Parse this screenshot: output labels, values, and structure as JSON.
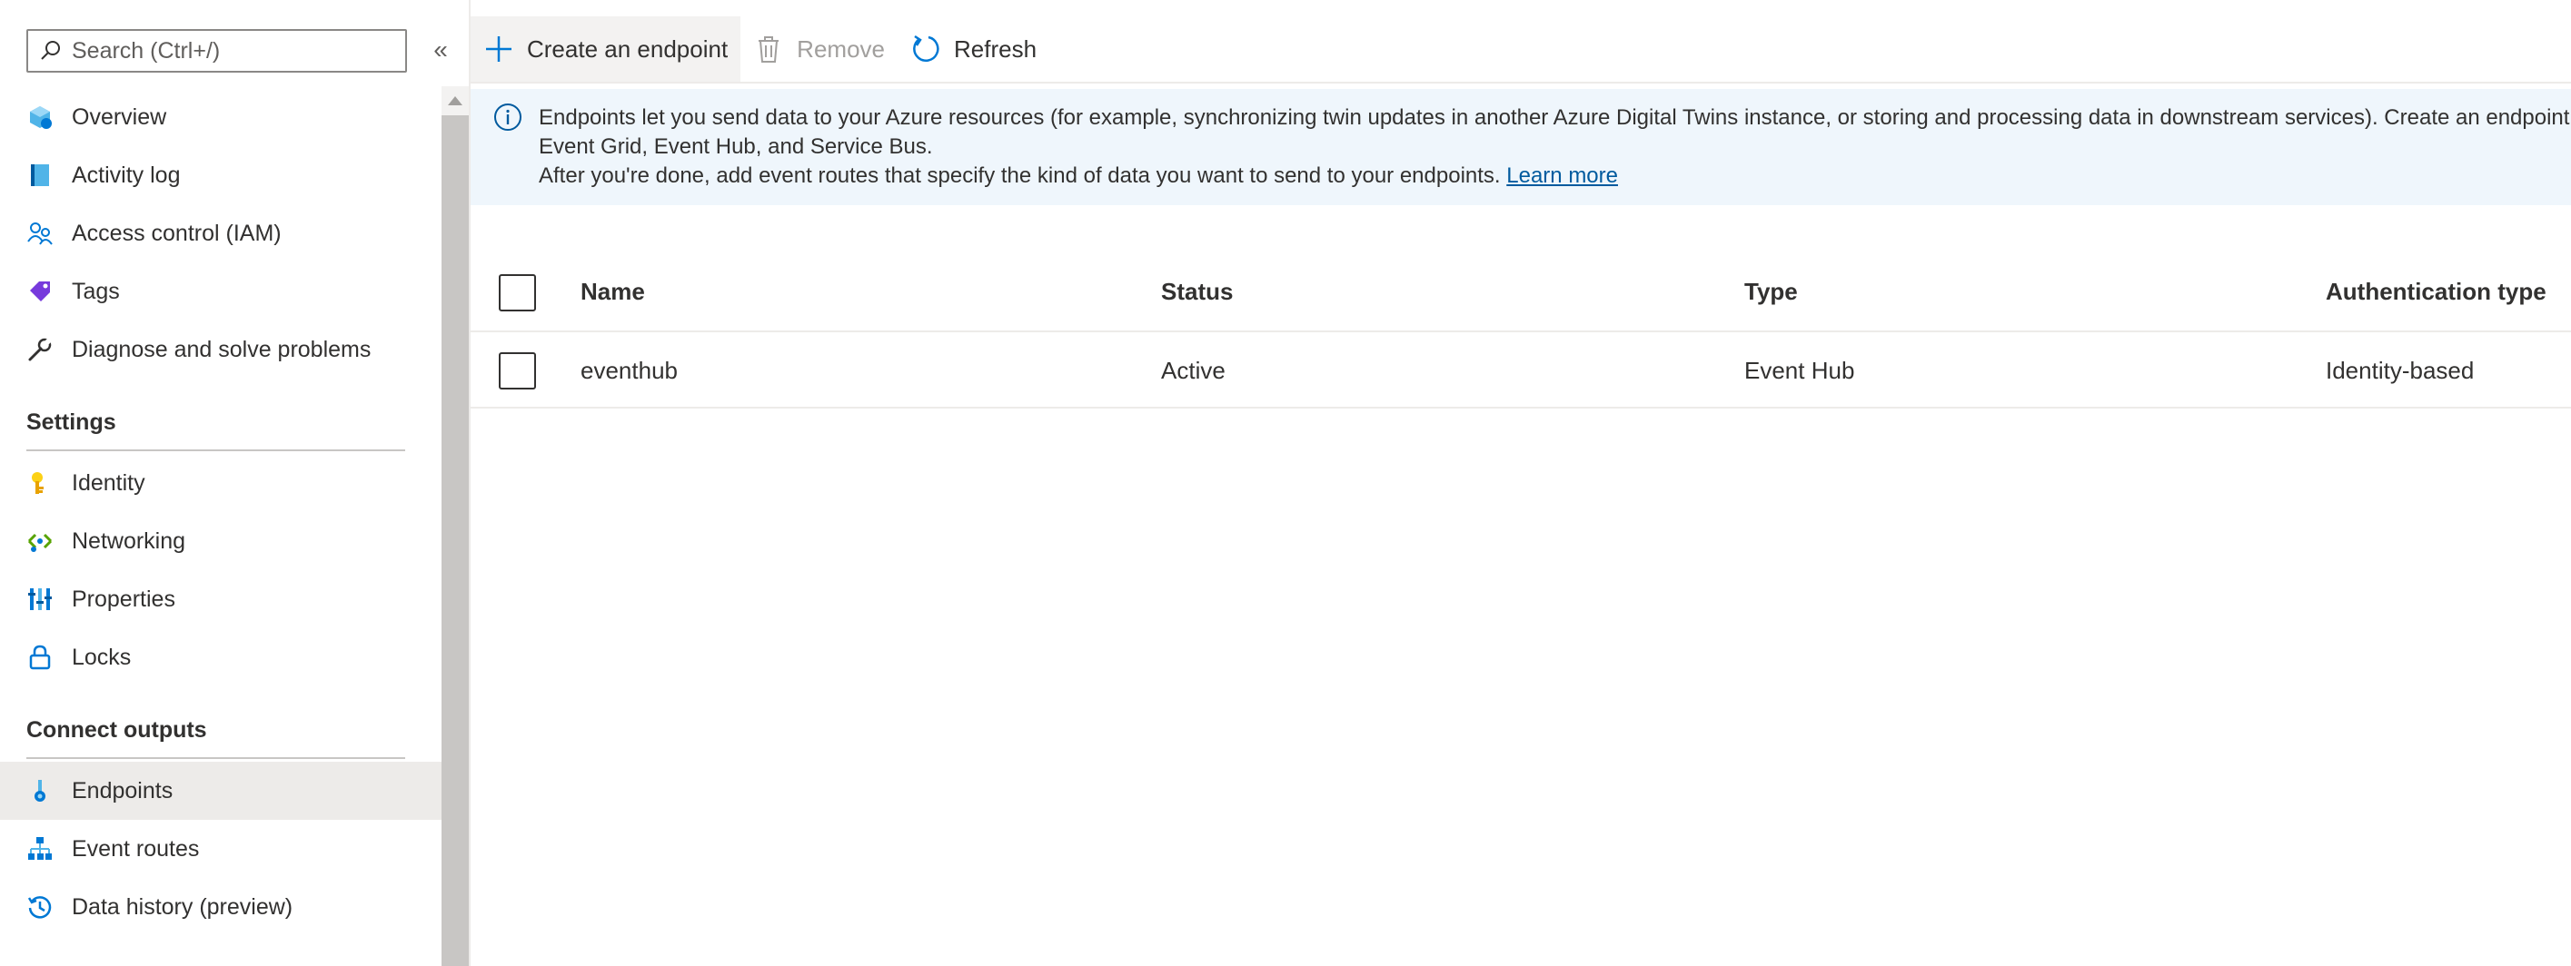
{
  "search": {
    "placeholder": "Search (Ctrl+/)"
  },
  "collapse": {
    "glyph": "«"
  },
  "nav": {
    "top_items": [
      {
        "label": "Overview",
        "icon": "overview-icon"
      },
      {
        "label": "Activity log",
        "icon": "activity-log-icon"
      },
      {
        "label": "Access control (IAM)",
        "icon": "iam-icon"
      },
      {
        "label": "Tags",
        "icon": "tag-icon"
      },
      {
        "label": "Diagnose and solve problems",
        "icon": "wrench-icon"
      }
    ],
    "settings_header": "Settings",
    "settings_items": [
      {
        "label": "Identity",
        "icon": "key-icon"
      },
      {
        "label": "Networking",
        "icon": "networking-icon"
      },
      {
        "label": "Properties",
        "icon": "properties-icon"
      },
      {
        "label": "Locks",
        "icon": "lock-icon"
      }
    ],
    "connect_header": "Connect outputs",
    "connect_items": [
      {
        "label": "Endpoints",
        "icon": "endpoint-icon",
        "selected": true
      },
      {
        "label": "Event routes",
        "icon": "event-routes-icon"
      },
      {
        "label": "Data history (preview)",
        "icon": "history-icon"
      }
    ]
  },
  "toolbar": {
    "create_label": "Create an endpoint",
    "remove_label": "Remove",
    "refresh_label": "Refresh"
  },
  "banner": {
    "line1": "Endpoints let you send data to your Azure resources (for example, synchronizing twin updates in another Azure Digital Twins instance, or storing and processing data in downstream services). Create an endpoint f",
    "line2": "Event Grid, Event Hub, and Service Bus.",
    "line3": "After you're done, add event routes that specify the kind of data you want to send to your endpoints.",
    "link": "Learn more"
  },
  "table": {
    "columns": [
      "Name",
      "Status",
      "Type",
      "Authentication type"
    ],
    "rows": [
      {
        "name": "eventhub",
        "status": "Active",
        "type": "Event Hub",
        "auth": "Identity-based"
      }
    ]
  },
  "colors": {
    "accent": "#0078d4",
    "selected_bg": "#edebe9",
    "banner_bg": "#eff6fc",
    "link": "#005a9e"
  }
}
